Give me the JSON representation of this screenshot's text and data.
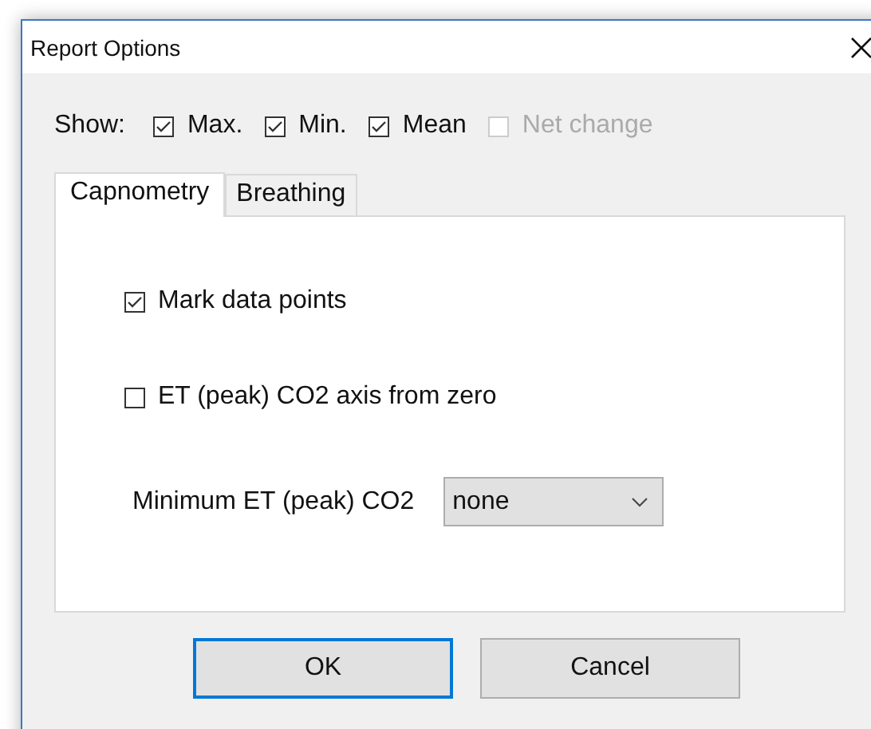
{
  "window": {
    "title": "Report Options"
  },
  "show": {
    "label": "Show:",
    "options": [
      {
        "label": "Max.",
        "checked": true,
        "disabled": false
      },
      {
        "label": "Min.",
        "checked": true,
        "disabled": false
      },
      {
        "label": "Mean",
        "checked": true,
        "disabled": false
      },
      {
        "label": "Net change",
        "checked": false,
        "disabled": true
      }
    ]
  },
  "tabs": [
    {
      "label": "Capnometry",
      "selected": true
    },
    {
      "label": "Breathing",
      "selected": false
    }
  ],
  "panel": [
    {
      "kind": "checkbox",
      "label": "Mark data points",
      "checked": true
    },
    {
      "kind": "checkbox",
      "label": "ET (peak) CO2 axis from zero",
      "checked": false
    },
    {
      "kind": "dropdown",
      "label": "Minimum ET (peak) CO2",
      "value": "none"
    }
  ],
  "buttons": [
    {
      "label": "OK",
      "default": true
    },
    {
      "label": "Cancel",
      "default": false
    }
  ]
}
